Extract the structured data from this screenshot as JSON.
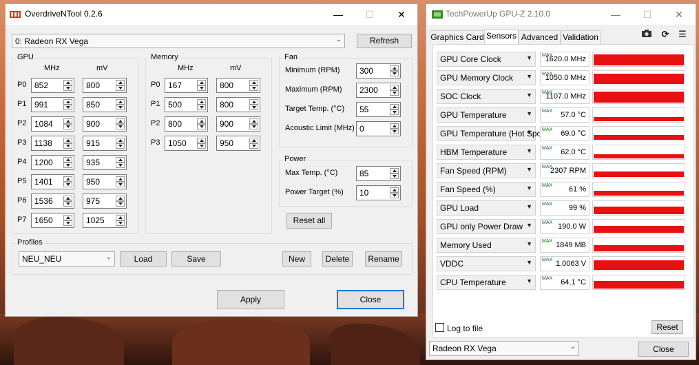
{
  "overdrive": {
    "title": "OverdriveNTool 0.2.6",
    "device_select": "0: Radeon RX Vega",
    "refresh_label": "Refresh",
    "gpu": {
      "group_label": "GPU",
      "col_mhz": "MHz",
      "col_mv": "mV",
      "states": [
        {
          "p": "P0",
          "mhz": "852",
          "mv": "800"
        },
        {
          "p": "P1",
          "mhz": "991",
          "mv": "850"
        },
        {
          "p": "P2",
          "mhz": "1084",
          "mv": "900"
        },
        {
          "p": "P3",
          "mhz": "1138",
          "mv": "915"
        },
        {
          "p": "P4",
          "mhz": "1200",
          "mv": "935"
        },
        {
          "p": "P5",
          "mhz": "1401",
          "mv": "950"
        },
        {
          "p": "P6",
          "mhz": "1536",
          "mv": "975"
        },
        {
          "p": "P7",
          "mhz": "1650",
          "mv": "1025"
        }
      ]
    },
    "memory": {
      "group_label": "Memory",
      "col_mhz": "MHz",
      "col_mv": "mV",
      "states": [
        {
          "p": "P0",
          "mhz": "167",
          "mv": "800"
        },
        {
          "p": "P1",
          "mhz": "500",
          "mv": "800"
        },
        {
          "p": "P2",
          "mhz": "800",
          "mv": "900"
        },
        {
          "p": "P3",
          "mhz": "1050",
          "mv": "950"
        }
      ]
    },
    "fan": {
      "group_label": "Fan",
      "rows": [
        {
          "label": "Minimum (RPM)",
          "value": "300"
        },
        {
          "label": "Maximum (RPM)",
          "value": "2300"
        },
        {
          "label": "Target Temp. (°C)",
          "value": "55"
        },
        {
          "label": "Acoustic Limit (MHz)",
          "value": "0"
        }
      ]
    },
    "power": {
      "group_label": "Power",
      "rows": [
        {
          "label": "Max Temp. (°C)",
          "value": "85"
        },
        {
          "label": "Power Target (%)",
          "value": "10"
        }
      ]
    },
    "reset_all_label": "Reset all",
    "profiles": {
      "group_label": "Profiles",
      "selected": "NEU_NEU",
      "load_label": "Load",
      "save_label": "Save",
      "new_label": "New",
      "delete_label": "Delete",
      "rename_label": "Rename"
    },
    "apply_label": "Apply",
    "close_label": "Close"
  },
  "gpuz": {
    "title": "TechPowerUp GPU-Z 2.10.0",
    "tabs": [
      {
        "label": "Graphics Card"
      },
      {
        "label": "Sensors"
      },
      {
        "label": "Advanced"
      },
      {
        "label": "Validation"
      }
    ],
    "max_tag": "MAX",
    "sensors": [
      {
        "name": "GPU Core Clock",
        "value": "1620.0 MHz",
        "level": 0.82
      },
      {
        "name": "GPU Memory Clock",
        "value": "1050.0 MHz",
        "level": 0.78
      },
      {
        "name": "SOC Clock",
        "value": "1107.0 MHz",
        "level": 0.85
      },
      {
        "name": "GPU Temperature",
        "value": "57.0 °C",
        "level": 0.3
      },
      {
        "name": "GPU Temperature (Hot Spot)",
        "value": "69.0 °C",
        "level": 0.35
      },
      {
        "name": "HBM Temperature",
        "value": "62.0 °C",
        "level": 0.3
      },
      {
        "name": "Fan Speed (RPM)",
        "value": "2307 RPM",
        "level": 0.4
      },
      {
        "name": "Fan Speed (%)",
        "value": "61 %",
        "level": 0.38
      },
      {
        "name": "GPU Load",
        "value": "99 %",
        "level": 0.6
      },
      {
        "name": "GPU only Power Draw",
        "value": "190.0 W",
        "level": 0.55
      },
      {
        "name": "Memory Used",
        "value": "1849 MB",
        "level": 0.45
      },
      {
        "name": "VDDC",
        "value": "1.0063 V",
        "level": 0.75
      },
      {
        "name": "CPU Temperature",
        "value": "64.1 °C",
        "level": 0.6
      }
    ],
    "log_to_file_label": "Log to file",
    "reset_label": "Reset",
    "device_select": "Radeon RX Vega",
    "close_label": "Close"
  },
  "colors": {
    "graph": "#e81010",
    "focus": "#0078d7"
  }
}
